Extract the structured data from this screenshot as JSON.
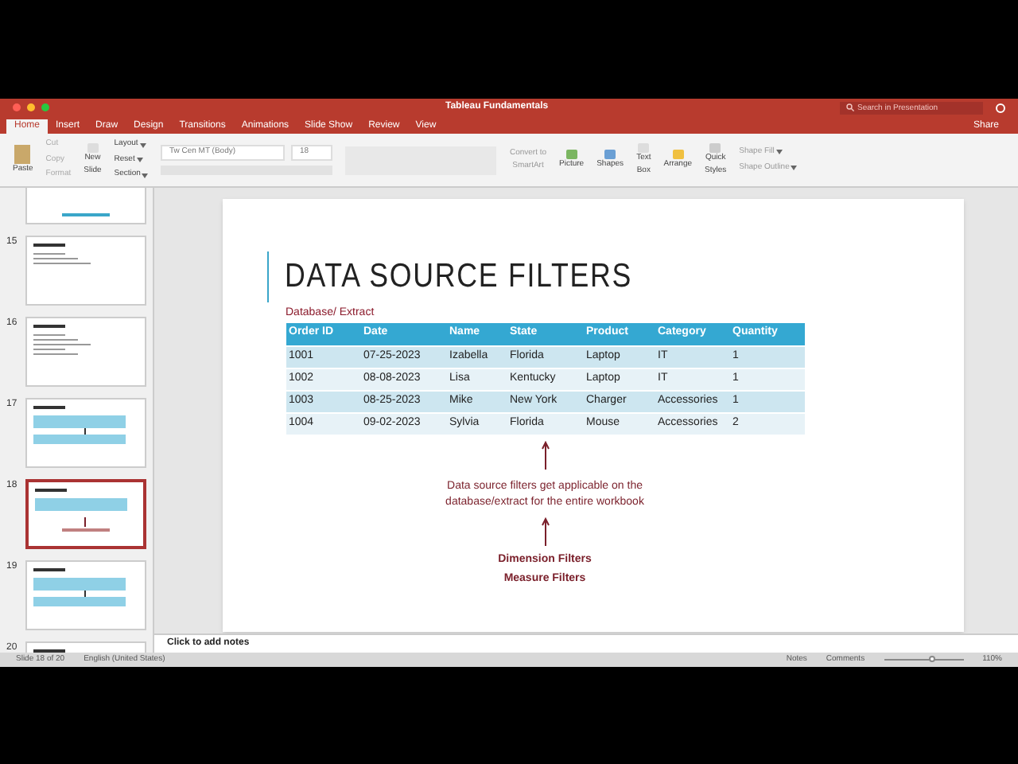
{
  "window": {
    "title": "Tableau Fundamentals",
    "search": {
      "placeholder": "Search in Presentation"
    },
    "share": "Share"
  },
  "tabs": [
    {
      "label": "Home",
      "selected": true
    },
    {
      "label": "Insert",
      "selected": false
    },
    {
      "label": "Draw",
      "selected": false
    },
    {
      "label": "Design",
      "selected": false
    },
    {
      "label": "Transitions",
      "selected": false
    },
    {
      "label": "Animations",
      "selected": false
    },
    {
      "label": "Slide Show",
      "selected": false
    },
    {
      "label": "Review",
      "selected": false
    },
    {
      "label": "View",
      "selected": false
    }
  ],
  "ribbon": {
    "paste": "Paste",
    "clipboard": [
      "Cut",
      "Copy",
      "Format"
    ],
    "new_slide": [
      "New",
      "Slide"
    ],
    "slide_tools": [
      "Layout",
      "Reset",
      "Section"
    ],
    "font": "Tw Cen MT (Body)",
    "font_size": "18",
    "smartart": [
      "Convert to",
      "SmartArt"
    ],
    "insert": [
      {
        "kind": "picture",
        "label": [
          "Picture"
        ]
      },
      {
        "kind": "shapes",
        "label": [
          "Shapes"
        ]
      },
      {
        "kind": "textbox",
        "label": [
          "Text",
          "Box"
        ]
      },
      {
        "kind": "arrange",
        "label": [
          "Arrange"
        ]
      },
      {
        "kind": "styles",
        "label": [
          "Quick",
          "Styles"
        ]
      }
    ],
    "shape_fill": "Shape Fill",
    "shape_outline": "Shape Outline"
  },
  "thumbnails": [
    {
      "selected": false,
      "kind": "title"
    },
    {
      "number": "15",
      "selected": false,
      "kind": "text"
    },
    {
      "number": "16",
      "selected": false,
      "kind": "list"
    },
    {
      "number": "17",
      "selected": false,
      "kind": "tables"
    },
    {
      "number": "18",
      "selected": true,
      "kind": "table"
    },
    {
      "number": "19",
      "selected": false,
      "kind": "tables"
    },
    {
      "number": "20",
      "selected": false,
      "kind": "text"
    }
  ],
  "slide": {
    "title": "DATA SOURCE FILTERS",
    "subtitle": "Database/ Extract",
    "table": {
      "columns": [
        "Order ID",
        "Date",
        "Name",
        "State",
        "Product",
        "Category",
        "Quantity"
      ],
      "rows": [
        [
          "1001",
          "07-25-2023",
          "Izabella",
          "Florida",
          "Laptop",
          "IT",
          "1"
        ],
        [
          "1002",
          "08-08-2023",
          "Lisa",
          "Kentucky",
          "Laptop",
          "IT",
          "1"
        ],
        [
          "1003",
          "08-25-2023",
          "Mike",
          "New York",
          "Charger",
          "Accessories",
          "1"
        ],
        [
          "1004",
          "09-02-2023",
          "Sylvia",
          "Florida",
          "Mouse",
          "Accessories",
          "2"
        ]
      ]
    },
    "note": [
      "Data source filters get applicable on the",
      "database/extract for the entire workbook"
    ],
    "filters": [
      "Dimension Filters",
      "Measure Filters"
    ]
  },
  "notes": {
    "placeholder": "Click to add notes"
  },
  "status_bar": {
    "slide": "Slide 18 of 20",
    "language": "English (United States)",
    "notes": "Notes",
    "comments": "Comments",
    "zoom": {
      "level": 0.6
    },
    "zoom_text": "110%"
  }
}
